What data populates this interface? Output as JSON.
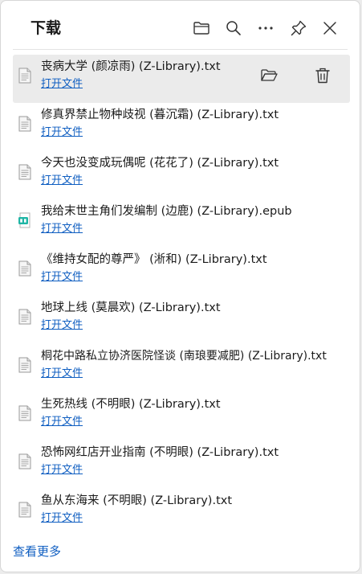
{
  "header": {
    "title": "下载"
  },
  "items": [
    {
      "name": "丧病大学 (颜凉雨) (Z-Library).txt",
      "open_label": "打开文件",
      "type": "txt"
    },
    {
      "name": "修真界禁止物种歧视 (暮沉霜) (Z-Library).txt",
      "open_label": "打开文件",
      "type": "txt"
    },
    {
      "name": "今天也没变成玩偶呢 (花花了) (Z-Library).txt",
      "open_label": "打开文件",
      "type": "txt"
    },
    {
      "name": "我给末世主角们发编制 (边鹿) (Z-Library).epub",
      "open_label": "打开文件",
      "type": "epub"
    },
    {
      "name": "《维持女配的尊严》 (淅和) (Z-Library).txt",
      "open_label": "打开文件",
      "type": "txt"
    },
    {
      "name": "地球上线 (莫晨欢) (Z-Library).txt",
      "open_label": "打开文件",
      "type": "txt"
    },
    {
      "name": "桐花中路私立协济医院怪谈 (南琅要减肥) (Z-Library).txt",
      "open_label": "打开文件",
      "type": "txt"
    },
    {
      "name": "生死热线 (不明眼) (Z-Library).txt",
      "open_label": "打开文件",
      "type": "txt"
    },
    {
      "name": "恐怖网红店开业指南 (不明眼) (Z-Library).txt",
      "open_label": "打开文件",
      "type": "txt"
    },
    {
      "name": "鱼从东海来 (不明眼) (Z-Library).txt",
      "open_label": "打开文件",
      "type": "txt"
    }
  ],
  "footer": {
    "see_more": "查看更多"
  },
  "colors": {
    "link": "#0f5ec1",
    "hover_row": "#ebebeb",
    "text": "#1b1b1b"
  }
}
